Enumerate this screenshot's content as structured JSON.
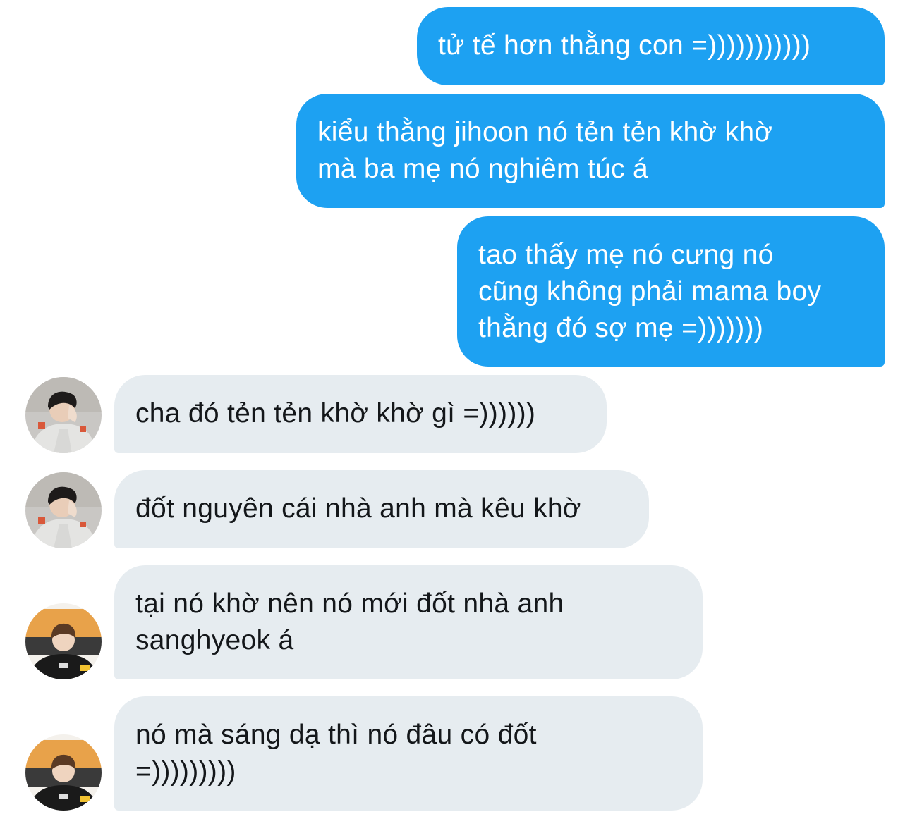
{
  "conversation": {
    "messages": [
      {
        "direction": "outgoing",
        "lines": [
          "tử tế hơn thằng con =)))))))))))"
        ]
      },
      {
        "direction": "outgoing",
        "lines": [
          "kiểu thằng jihoon nó tẻn tẻn khờ khờ",
          "mà ba mẹ nó nghiêm túc á"
        ]
      },
      {
        "direction": "outgoing",
        "lines": [
          "tao thấy mẹ nó cưng nó",
          "cũng không phải mama boy",
          "thằng đó sợ mẹ =)))))))"
        ]
      },
      {
        "direction": "incoming",
        "avatar": "avatar-user-a",
        "lines": [
          "cha đó tẻn tẻn khờ khờ gì =))))))"
        ]
      },
      {
        "direction": "incoming",
        "avatar": "avatar-user-a",
        "lines": [
          "đốt nguyên cái nhà anh mà kêu khờ"
        ]
      },
      {
        "direction": "incoming",
        "avatar": "avatar-user-b",
        "lines": [
          "tại nó khờ nên nó mới đốt nhà anh",
          "sanghyeok á"
        ]
      },
      {
        "direction": "incoming",
        "avatar": "avatar-user-b",
        "lines": [
          "nó mà sáng dạ thì nó đâu có đốt",
          "=)))))))))"
        ]
      }
    ]
  },
  "colors": {
    "outgoing_bubble": "#1da1f2",
    "incoming_bubble": "#e6ecf0",
    "outgoing_text": "#ffffff",
    "incoming_text": "#14171a"
  }
}
